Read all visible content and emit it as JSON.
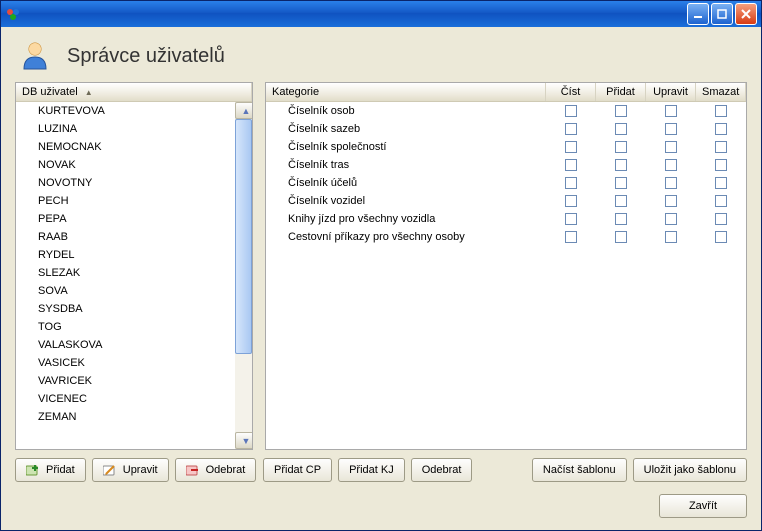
{
  "header": {
    "title": "Správce uživatelů"
  },
  "left": {
    "column": "DB uživatel",
    "users": [
      "KURTEVOVA",
      "LUZINA",
      "NEMOCNAK",
      "NOVAK",
      "NOVOTNY",
      "PECH",
      "PEPA",
      "RAAB",
      "RYDEL",
      "SLEZAK",
      "SOVA",
      "SYSDBA",
      "TOG",
      "VALASKOVA",
      "VASICEK",
      "VAVRICEK",
      "VICENEC",
      "ZEMAN"
    ]
  },
  "right": {
    "columns": {
      "category": "Kategorie",
      "read": "Číst",
      "add": "Přidat",
      "edit": "Upravit",
      "delete": "Smazat"
    },
    "categories": [
      "Číselník osob",
      "Číselník sazeb",
      "Číselník společností",
      "Číselník tras",
      "Číselník účelů",
      "Číselník vozidel",
      "Knihy jízd pro všechny vozidla",
      "Cestovní příkazy pro všechny osoby"
    ]
  },
  "toolbar": {
    "left": {
      "add": "Přidat",
      "edit": "Upravit",
      "remove": "Odebrat"
    },
    "right": {
      "add_cp": "Přidat CP",
      "add_kj": "Přidat KJ",
      "remove": "Odebrat",
      "load_tpl": "Načíst šablonu",
      "save_tpl": "Uložit jako šablonu"
    }
  },
  "footer": {
    "close": "Zavřít"
  }
}
